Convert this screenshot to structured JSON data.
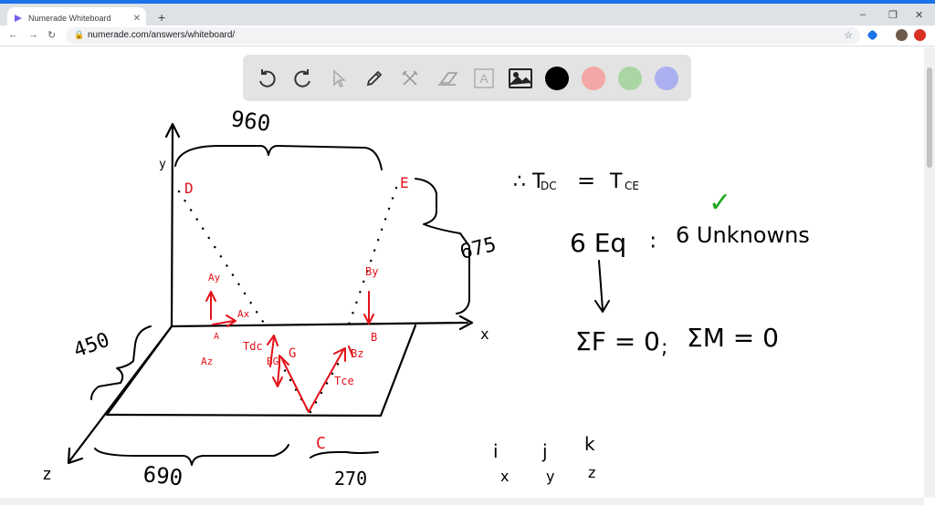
{
  "browser": {
    "tab_title": "Numerade Whiteboard",
    "tab_close": "✕",
    "new_tab": "+",
    "url": "numerade.com/answers/whiteboard/",
    "nav": {
      "back": "←",
      "forward": "→",
      "reload": "↻"
    },
    "window": {
      "minimize": "–",
      "maximize": "❐",
      "close": "✕"
    },
    "colors": {
      "accent": "#1a73e8",
      "tab_strip": "#dee1e6"
    }
  },
  "toolbar": {
    "tools": [
      "undo-icon",
      "redo-icon",
      "select-icon",
      "pen-icon",
      "tools-icon",
      "eraser-icon",
      "text-icon",
      "image-icon"
    ],
    "text_tool_glyph": "A",
    "colors": [
      "#000000",
      "#f4a7a7",
      "#a9d6a3",
      "#aab0ef"
    ]
  },
  "board": {
    "ink": "#000000",
    "red_ink": "#e3121b",
    "green_ink": "#1aa61a",
    "dimensions": {
      "top": "960",
      "right": "675",
      "left": "450",
      "bottom_left": "690",
      "bottom_right": "270"
    },
    "axes": {
      "x": "x",
      "y": "y",
      "z": "z"
    },
    "points": {
      "D": "D",
      "E": "E",
      "C": "C",
      "B": "B",
      "A": "A",
      "G": "G"
    },
    "forces": {
      "ay": "Ay",
      "ax": "Ax",
      "az": "Az",
      "by": "By",
      "bz": "Bz",
      "tdc": "Tdc",
      "tce": "Tce",
      "bg": "BG"
    },
    "notes": {
      "line1_lhs": "∴ T",
      "line1_lhs_sub": "DC",
      "line1_eq": "=",
      "line1_rhs": "T",
      "line1_rhs_sub": "CE",
      "check": "✓",
      "eq_count": "6 Eq",
      "sep": "∶",
      "unknowns": "6 Unknowns",
      "sum_f": "ΣF = 0",
      "semicolon": ";",
      "sum_m": "ΣM = 0",
      "ijk": [
        "i",
        "j",
        "k"
      ],
      "xyz": [
        "x",
        "y",
        "z"
      ]
    }
  }
}
